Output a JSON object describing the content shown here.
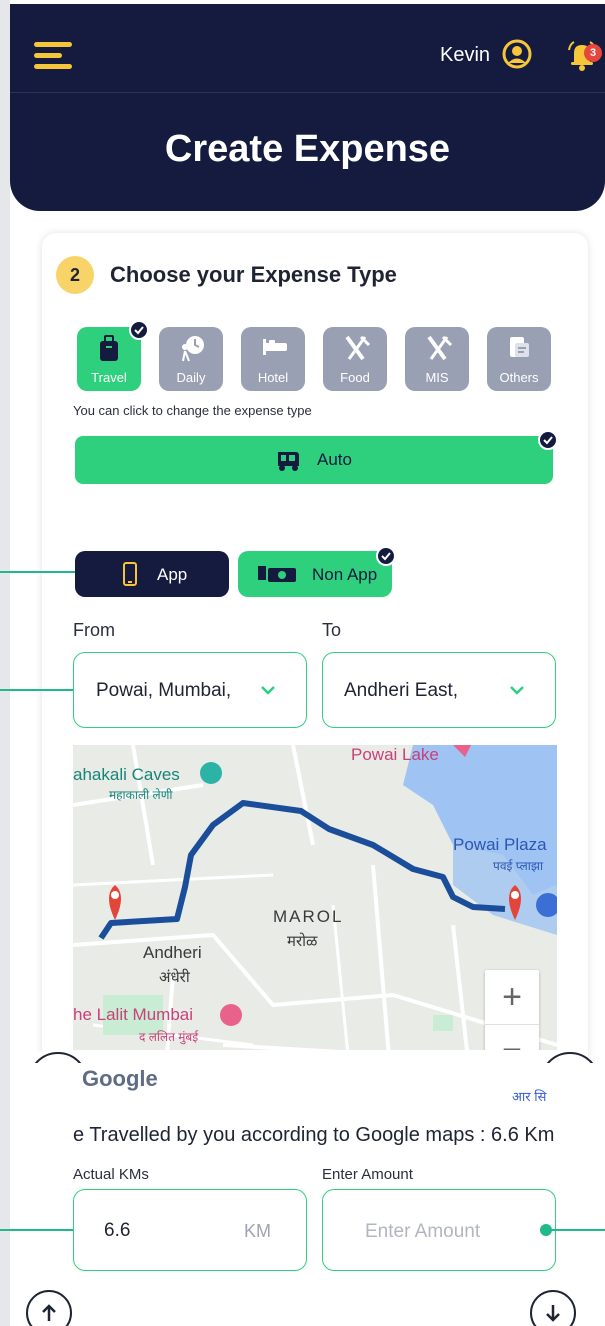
{
  "header": {
    "user_name": "Kevin",
    "notification_count": "3",
    "title": "Create Expense"
  },
  "step": {
    "number": "2",
    "title": "Choose your Expense Type"
  },
  "expense_types": [
    {
      "label": "Travel",
      "icon": "luggage-icon",
      "selected": true
    },
    {
      "label": "Daily",
      "icon": "daily-clock-icon",
      "selected": false
    },
    {
      "label": "Hotel",
      "icon": "bed-icon",
      "selected": false
    },
    {
      "label": "Food",
      "icon": "fork-knife-icon",
      "selected": false
    },
    {
      "label": "MIS",
      "icon": "fork-knife-icon",
      "selected": false
    },
    {
      "label": "Others",
      "icon": "receipt-icon",
      "selected": false
    }
  ],
  "hint_text": "You can click to change the expense type",
  "travel_mode": {
    "label": "Auto",
    "icon": "auto-rickshaw-icon",
    "selected": true
  },
  "booking": {
    "app_label": "App",
    "non_app_label": "Non App",
    "selected": "Non App"
  },
  "route": {
    "from_label": "From",
    "to_label": "To",
    "from_value": "Powai, Mumbai,",
    "to_value": "Andheri East,"
  },
  "map": {
    "labels": {
      "powai_lake": "Powai Lake",
      "mahakali": "ahakali Caves",
      "mahakali_hi": "महाकाली लेणी",
      "powai_plaza": "Powai Plaza",
      "powai_plaza_hi": "पवई प्लाझा",
      "marol": "MAROL",
      "marol_hi": "मरोळ",
      "andheri": "Andheri",
      "andheri_hi": "अंधेरी",
      "lalit": "he Lalit Mumbai",
      "lalit_hi": "द ललित मुंबई",
      "attribution_hi": "आर सि"
    },
    "google_logo": "Google",
    "zoom_in": "+",
    "zoom_out": "−"
  },
  "distance_text": "e Travelled by you according to Google maps : 6.6 Km",
  "actual_kms": {
    "label": "Actual KMs",
    "value": "6.6",
    "unit": "KM"
  },
  "amount": {
    "label": "Enter Amount",
    "placeholder": "Enter Amount"
  },
  "colors": {
    "navy": "#141b3e",
    "green": "#2ed07e",
    "yellow": "#f5c63a",
    "gray_tile": "#9aa0b4",
    "annotation": "#1fb98c"
  }
}
